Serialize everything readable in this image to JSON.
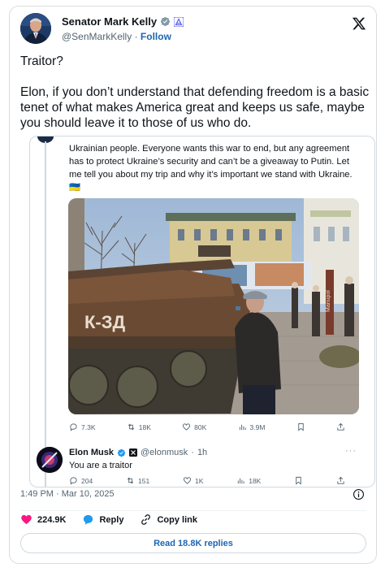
{
  "author": {
    "name": "Senator Mark Kelly",
    "handle": "@SenMarkKelly",
    "follow_label": "Follow",
    "separator": "·"
  },
  "tweet": {
    "text": "Traitor?\n\nElon, if you don’t understand that defending freedom is a basic tenet of what makes America great and keeps us safe, maybe you should leave it to those of us who do."
  },
  "quoted": {
    "text": "Ukrainian people. Everyone wants this war to end, but any agreement has to protect Ukraine’s security and can’t be a giveaway to Putin. Let me tell you about my trip and why it’s important we stand with Ukraine. 🇺🇦",
    "photo_text": {
      "tank_graffiti": "К-ЗД",
      "sign": "Mariupol"
    },
    "stats": {
      "replies": "7.3K",
      "reposts": "18K",
      "likes": "80K",
      "views": "3.9M"
    }
  },
  "reply": {
    "name": "Elon Musk",
    "handle": "@elonmusk",
    "time": "1h",
    "separator": "·",
    "more": "···",
    "text": "You are a traitor",
    "stats": {
      "replies": "204",
      "reposts": "151",
      "likes": "1K",
      "views": "18K"
    }
  },
  "timestamp": "1:49 PM · Mar 10, 2025",
  "engagement": {
    "likes": "224.9K",
    "reply_label": "Reply",
    "copy_link_label": "Copy link"
  },
  "read_replies_label": "Read 18.8K replies",
  "colors": {
    "verified": "#1d9bf0",
    "link": "#1d65b3",
    "heart": "#f91880",
    "muted": "#536471",
    "border": "#cfd9de"
  },
  "icons": [
    "verified-badge-icon",
    "government-badge-icon",
    "x-logo-icon",
    "reply-icon",
    "repost-icon",
    "like-icon",
    "views-icon",
    "bookmark-icon",
    "share-icon",
    "info-icon",
    "heart-icon",
    "chat-bubble-icon",
    "link-icon"
  ]
}
